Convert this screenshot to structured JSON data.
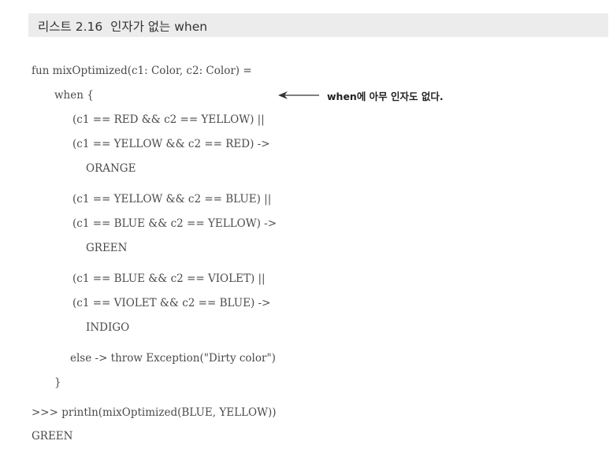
{
  "listing": {
    "title": "리스트 2.16  인자가 없는 when"
  },
  "code": {
    "lines": [
      "fun mixOptimized(c1: Color, c2: Color) =",
      "when {",
      "(c1 == RED && c2 == YELLOW) ||",
      "(c1 == YELLOW && c2 == RED) ->",
      "ORANGE",
      "(c1 == YELLOW && c2 == BLUE) ||",
      "(c1 == BLUE && c2 == YELLOW) ->",
      "GREEN",
      "(c1 == BLUE && c2 == VIOLET) ||",
      "(c1 == VIOLET && c2 == BLUE) ->",
      "INDIGO",
      "else -> throw Exception(\"Dirty color\")",
      "}",
      ">>> println(mixOptimized(BLUE, YELLOW))",
      "GREEN"
    ]
  },
  "annotation": {
    "text": "when에 아무 인자도 없다.",
    "icon": "left-arrow-icon"
  }
}
